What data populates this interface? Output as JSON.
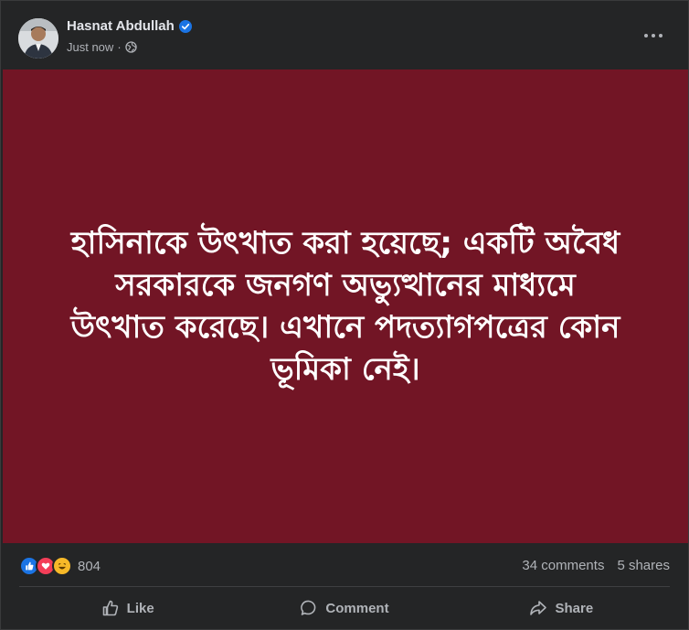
{
  "post": {
    "author": "Hasnat Abdullah",
    "timestamp": "Just now",
    "verified": true,
    "privacy_icon": "globe-icon",
    "background_color": "#721525",
    "text": "হাসিনাকে উৎখাত করা হয়েছে; একটি অবৈধ\nসরকারকে জনগণ অভ্যুত্থানের মাধ্যমে\nউৎখাত করেছে। এখানে পদত্যাগপত্রের কোন\nভূমিকা নেই।"
  },
  "reactions": {
    "icons": [
      "like-icon",
      "love-icon",
      "haha-icon"
    ],
    "count": "804"
  },
  "stats": {
    "comments": "34 comments",
    "shares": "5 shares"
  },
  "actions": {
    "like_label": "Like",
    "comment_label": "Comment",
    "share_label": "Share"
  }
}
